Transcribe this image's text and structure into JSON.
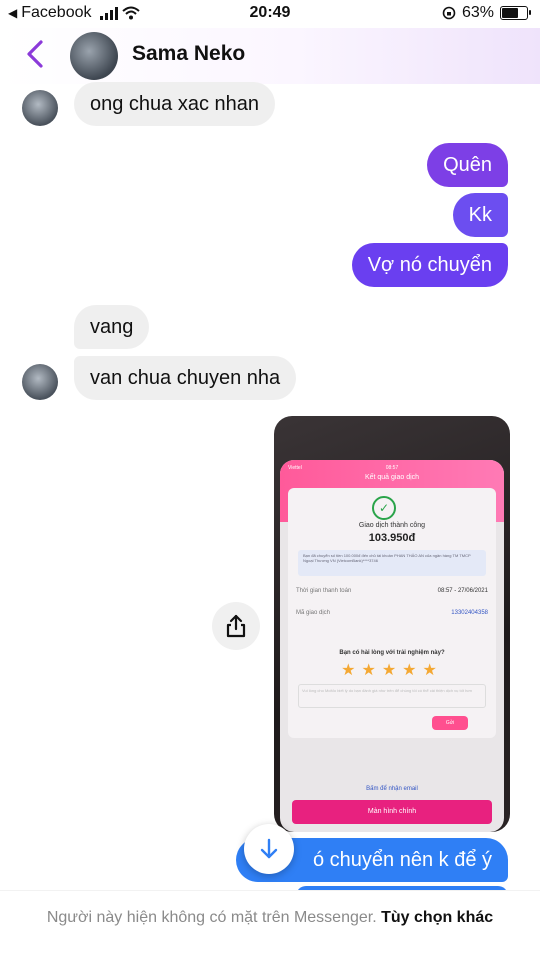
{
  "status_bar": {
    "back_app": "Facebook",
    "time": "20:49",
    "battery": "63%"
  },
  "header": {
    "contact_name": "Sama Neko"
  },
  "colors": {
    "accent": "#8b3ad9",
    "bubble_out_top": "#8a3fe0",
    "bubble_out_bottom": "#2f7ff5",
    "bubble_in": "#efefef"
  },
  "messages": [
    {
      "sender": "contact",
      "text": "ong chua xac nhan"
    },
    {
      "sender": "me",
      "text": "Quên"
    },
    {
      "sender": "me",
      "text": "Kk"
    },
    {
      "sender": "me",
      "text": "Vợ nó chuyển"
    },
    {
      "sender": "contact",
      "text": "vang"
    },
    {
      "sender": "contact",
      "text": "van chua chuyen nha"
    },
    {
      "sender": "me",
      "text": "ó chuyển nên k để ý"
    }
  ],
  "photo": {
    "carrier": "Viettel",
    "clock": "08:57",
    "screen_title": "Kết quả giao dịch",
    "status": "Giao dịch thành công",
    "amount": "103.950đ",
    "note": "Bạn đã chuyển số tiền 100.000đ đến chủ tài khoản PHAN THẢO AN của ngân hàng TM TMCP Ngoại Thương VN (VietcomBank)****3746",
    "time_label": "Thời gian thanh toán",
    "time_value": "08:57 - 27/06/2021",
    "txn_label": "Mã giao dịch",
    "txn_value": "13302404358",
    "question": "Bạn có hài lòng với trải nghiệm này?",
    "stars": "★★★★★",
    "input_placeholder": "Vui lòng cho MoMo biết lý do bạn đánh giá như trên để chúng tôi có thể cải thiện dịch vụ tốt hơn",
    "send_label": "Gửi",
    "email_label": "Bấm để nhận email",
    "main_button": "Màn hình chính"
  },
  "footer": {
    "message": "Người này hiện không có mặt trên Messenger.",
    "link": "Tùy chọn khác"
  }
}
